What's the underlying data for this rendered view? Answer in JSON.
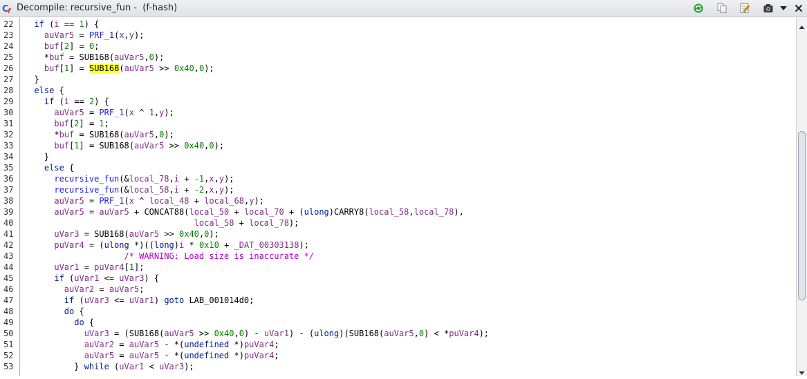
{
  "window": {
    "title": "Decompile: recursive_fun -  (f-hash)",
    "icons": [
      "decompile-logo-icon",
      "refresh-icon",
      "copy-icon",
      "edit-icon",
      "snapshot-icon",
      "menu-chevron-icon",
      "close-icon"
    ]
  },
  "colors": {
    "keyword": "#001a8c",
    "function": "#1e1ee0",
    "variable": "#7d2d83",
    "constant": "#008000",
    "comment": "#b000c8",
    "highlight": "#ffff40"
  },
  "lines": [
    {
      "n": "22",
      "i": 1,
      "t": [
        {
          "c": "kw",
          "s": "if"
        },
        {
          "s": " ("
        },
        {
          "c": "var",
          "s": "i"
        },
        {
          "s": " == "
        },
        {
          "c": "num",
          "s": "1"
        },
        {
          "s": ") {"
        }
      ]
    },
    {
      "n": "23",
      "i": 2,
      "t": [
        {
          "c": "var",
          "s": "auVar5"
        },
        {
          "s": " = "
        },
        {
          "c": "fn",
          "s": "PRF_1"
        },
        {
          "s": "("
        },
        {
          "c": "var",
          "s": "x"
        },
        {
          "s": ","
        },
        {
          "c": "var",
          "s": "y"
        },
        {
          "s": ");"
        }
      ]
    },
    {
      "n": "24",
      "i": 2,
      "t": [
        {
          "c": "var",
          "s": "buf"
        },
        {
          "s": "["
        },
        {
          "c": "num",
          "s": "2"
        },
        {
          "s": "] = "
        },
        {
          "c": "num",
          "s": "0"
        },
        {
          "s": ";"
        }
      ]
    },
    {
      "n": "25",
      "i": 2,
      "t": [
        {
          "s": "*"
        },
        {
          "c": "var",
          "s": "buf"
        },
        {
          "s": " = SUB168("
        },
        {
          "c": "var",
          "s": "auVar5"
        },
        {
          "s": ","
        },
        {
          "c": "num",
          "s": "0"
        },
        {
          "s": ");"
        }
      ]
    },
    {
      "n": "26",
      "i": 2,
      "t": [
        {
          "c": "var",
          "s": "buf"
        },
        {
          "s": "["
        },
        {
          "c": "num",
          "s": "1"
        },
        {
          "s": "] = "
        },
        {
          "c": "hl",
          "s": "SUB168"
        },
        {
          "s": "("
        },
        {
          "c": "var",
          "s": "auVar5"
        },
        {
          "s": " >> "
        },
        {
          "c": "num",
          "s": "0x40"
        },
        {
          "s": ","
        },
        {
          "c": "num",
          "s": "0"
        },
        {
          "s": ");"
        }
      ]
    },
    {
      "n": "27",
      "i": 1,
      "t": [
        {
          "s": "}"
        }
      ]
    },
    {
      "n": "28",
      "i": 1,
      "t": [
        {
          "c": "kw",
          "s": "else"
        },
        {
          "s": " {"
        }
      ]
    },
    {
      "n": "29",
      "i": 2,
      "t": [
        {
          "c": "kw",
          "s": "if"
        },
        {
          "s": " ("
        },
        {
          "c": "var",
          "s": "i"
        },
        {
          "s": " == "
        },
        {
          "c": "num",
          "s": "2"
        },
        {
          "s": ") {"
        }
      ]
    },
    {
      "n": "30",
      "i": 3,
      "t": [
        {
          "c": "var",
          "s": "auVar5"
        },
        {
          "s": " = "
        },
        {
          "c": "fn",
          "s": "PRF_1"
        },
        {
          "s": "("
        },
        {
          "c": "var",
          "s": "x"
        },
        {
          "s": " ^ "
        },
        {
          "c": "num",
          "s": "1"
        },
        {
          "s": ","
        },
        {
          "c": "var",
          "s": "y"
        },
        {
          "s": ");"
        }
      ]
    },
    {
      "n": "31",
      "i": 3,
      "t": [
        {
          "c": "var",
          "s": "buf"
        },
        {
          "s": "["
        },
        {
          "c": "num",
          "s": "2"
        },
        {
          "s": "] = "
        },
        {
          "c": "num",
          "s": "1"
        },
        {
          "s": ";"
        }
      ]
    },
    {
      "n": "32",
      "i": 3,
      "t": [
        {
          "s": "*"
        },
        {
          "c": "var",
          "s": "buf"
        },
        {
          "s": " = SUB168("
        },
        {
          "c": "var",
          "s": "auVar5"
        },
        {
          "s": ","
        },
        {
          "c": "num",
          "s": "0"
        },
        {
          "s": ");"
        }
      ]
    },
    {
      "n": "33",
      "i": 3,
      "t": [
        {
          "c": "var",
          "s": "buf"
        },
        {
          "s": "["
        },
        {
          "c": "num",
          "s": "1"
        },
        {
          "s": "] = SUB168("
        },
        {
          "c": "var",
          "s": "auVar5"
        },
        {
          "s": " >> "
        },
        {
          "c": "num",
          "s": "0x40"
        },
        {
          "s": ","
        },
        {
          "c": "num",
          "s": "0"
        },
        {
          "s": ");"
        }
      ]
    },
    {
      "n": "34",
      "i": 2,
      "t": [
        {
          "s": "}"
        }
      ]
    },
    {
      "n": "35",
      "i": 2,
      "t": [
        {
          "c": "kw",
          "s": "else"
        },
        {
          "s": " {"
        }
      ]
    },
    {
      "n": "36",
      "i": 3,
      "t": [
        {
          "c": "fn",
          "s": "recursive_fun"
        },
        {
          "s": "(&"
        },
        {
          "c": "var",
          "s": "local_78"
        },
        {
          "s": ","
        },
        {
          "c": "var",
          "s": "i"
        },
        {
          "s": " + "
        },
        {
          "c": "num",
          "s": "-1"
        },
        {
          "s": ","
        },
        {
          "c": "var",
          "s": "x"
        },
        {
          "s": ","
        },
        {
          "c": "var",
          "s": "y"
        },
        {
          "s": ");"
        }
      ]
    },
    {
      "n": "37",
      "i": 3,
      "t": [
        {
          "c": "fn",
          "s": "recursive_fun"
        },
        {
          "s": "(&"
        },
        {
          "c": "var",
          "s": "local_58"
        },
        {
          "s": ","
        },
        {
          "c": "var",
          "s": "i"
        },
        {
          "s": " + "
        },
        {
          "c": "num",
          "s": "-2"
        },
        {
          "s": ","
        },
        {
          "c": "var",
          "s": "x"
        },
        {
          "s": ","
        },
        {
          "c": "var",
          "s": "y"
        },
        {
          "s": ");"
        }
      ]
    },
    {
      "n": "38",
      "i": 3,
      "t": [
        {
          "c": "var",
          "s": "auVar5"
        },
        {
          "s": " = "
        },
        {
          "c": "fn",
          "s": "PRF_1"
        },
        {
          "s": "("
        },
        {
          "c": "var",
          "s": "x"
        },
        {
          "s": " ^ "
        },
        {
          "c": "var",
          "s": "local_48"
        },
        {
          "s": " + "
        },
        {
          "c": "var",
          "s": "local_68"
        },
        {
          "s": ","
        },
        {
          "c": "var",
          "s": "y"
        },
        {
          "s": ");"
        }
      ]
    },
    {
      "n": "39",
      "i": 3,
      "t": [
        {
          "c": "var",
          "s": "auVar5"
        },
        {
          "s": " = "
        },
        {
          "c": "var",
          "s": "auVar5"
        },
        {
          "s": " + CONCAT88("
        },
        {
          "c": "var",
          "s": "local_50"
        },
        {
          "s": " + "
        },
        {
          "c": "var",
          "s": "local_70"
        },
        {
          "s": " + ("
        },
        {
          "c": "kw",
          "s": "ulong"
        },
        {
          "s": ")CARRY8("
        },
        {
          "c": "var",
          "s": "local_58"
        },
        {
          "s": ","
        },
        {
          "c": "var",
          "s": "local_78"
        },
        {
          "s": "),"
        }
      ]
    },
    {
      "n": "40",
      "i": 0,
      "t": [
        {
          "s": "                                  "
        },
        {
          "c": "var",
          "s": "local_58"
        },
        {
          "s": " + "
        },
        {
          "c": "var",
          "s": "local_78"
        },
        {
          "s": ");"
        }
      ]
    },
    {
      "n": "41",
      "i": 3,
      "t": [
        {
          "c": "var",
          "s": "uVar3"
        },
        {
          "s": " = SUB168("
        },
        {
          "c": "var",
          "s": "auVar5"
        },
        {
          "s": " >> "
        },
        {
          "c": "num",
          "s": "0x40"
        },
        {
          "s": ","
        },
        {
          "c": "num",
          "s": "0"
        },
        {
          "s": ");"
        }
      ]
    },
    {
      "n": "42",
      "i": 3,
      "t": [
        {
          "c": "var",
          "s": "puVar4"
        },
        {
          "s": " = ("
        },
        {
          "c": "kw",
          "s": "ulong"
        },
        {
          "s": " *)(("
        },
        {
          "c": "kw",
          "s": "long"
        },
        {
          "s": ")"
        },
        {
          "c": "var",
          "s": "i"
        },
        {
          "s": " * "
        },
        {
          "c": "num",
          "s": "0x10"
        },
        {
          "s": " + "
        },
        {
          "c": "gv",
          "s": "_DAT_00303138"
        },
        {
          "s": ");"
        }
      ]
    },
    {
      "n": "43",
      "i": 0,
      "t": [
        {
          "s": "                    "
        },
        {
          "c": "cm",
          "s": "/* WARNING: Load size is inaccurate */"
        }
      ]
    },
    {
      "n": "44",
      "i": 3,
      "t": [
        {
          "c": "var",
          "s": "uVar1"
        },
        {
          "s": " = "
        },
        {
          "c": "var",
          "s": "puVar4"
        },
        {
          "s": "["
        },
        {
          "c": "num",
          "s": "1"
        },
        {
          "s": "];"
        }
      ]
    },
    {
      "n": "45",
      "i": 3,
      "t": [
        {
          "c": "kw",
          "s": "if"
        },
        {
          "s": " ("
        },
        {
          "c": "var",
          "s": "uVar1"
        },
        {
          "s": " <= "
        },
        {
          "c": "var",
          "s": "uVar3"
        },
        {
          "s": ") {"
        }
      ]
    },
    {
      "n": "46",
      "i": 4,
      "t": [
        {
          "c": "var",
          "s": "auVar2"
        },
        {
          "s": " = "
        },
        {
          "c": "var",
          "s": "auVar5"
        },
        {
          "s": ";"
        }
      ]
    },
    {
      "n": "47",
      "i": 4,
      "t": [
        {
          "c": "kw",
          "s": "if"
        },
        {
          "s": " ("
        },
        {
          "c": "var",
          "s": "uVar3"
        },
        {
          "s": " <= "
        },
        {
          "c": "var",
          "s": "uVar1"
        },
        {
          "s": ") "
        },
        {
          "c": "kw",
          "s": "goto"
        },
        {
          "s": " LAB_001014d0;"
        }
      ]
    },
    {
      "n": "48",
      "i": 4,
      "t": [
        {
          "c": "kw",
          "s": "do"
        },
        {
          "s": " {"
        }
      ]
    },
    {
      "n": "49",
      "i": 5,
      "t": [
        {
          "c": "kw",
          "s": "do"
        },
        {
          "s": " {"
        }
      ]
    },
    {
      "n": "50",
      "i": 6,
      "t": [
        {
          "c": "var",
          "s": "uVar3"
        },
        {
          "s": " = (SUB168("
        },
        {
          "c": "var",
          "s": "auVar5"
        },
        {
          "s": " >> "
        },
        {
          "c": "num",
          "s": "0x40"
        },
        {
          "s": ","
        },
        {
          "c": "num",
          "s": "0"
        },
        {
          "s": ") - "
        },
        {
          "c": "var",
          "s": "uVar1"
        },
        {
          "s": ") - ("
        },
        {
          "c": "kw",
          "s": "ulong"
        },
        {
          "s": ")(SUB168("
        },
        {
          "c": "var",
          "s": "auVar5"
        },
        {
          "s": ","
        },
        {
          "c": "num",
          "s": "0"
        },
        {
          "s": ") < *"
        },
        {
          "c": "var",
          "s": "puVar4"
        },
        {
          "s": ");"
        }
      ]
    },
    {
      "n": "51",
      "i": 6,
      "t": [
        {
          "c": "var",
          "s": "auVar2"
        },
        {
          "s": " = "
        },
        {
          "c": "var",
          "s": "auVar5"
        },
        {
          "s": " - *("
        },
        {
          "c": "kw",
          "s": "undefined"
        },
        {
          "s": " *)"
        },
        {
          "c": "var",
          "s": "puVar4"
        },
        {
          "s": ";"
        }
      ]
    },
    {
      "n": "52",
      "i": 6,
      "t": [
        {
          "c": "var",
          "s": "auVar5"
        },
        {
          "s": " = "
        },
        {
          "c": "var",
          "s": "auVar5"
        },
        {
          "s": " - *("
        },
        {
          "c": "kw",
          "s": "undefined"
        },
        {
          "s": " *)"
        },
        {
          "c": "var",
          "s": "puVar4"
        },
        {
          "s": ";"
        }
      ]
    },
    {
      "n": "53",
      "i": 5,
      "t": [
        {
          "s": "} "
        },
        {
          "c": "kw",
          "s": "while"
        },
        {
          "s": " ("
        },
        {
          "c": "var",
          "s": "uVar1"
        },
        {
          "s": " < "
        },
        {
          "c": "var",
          "s": "uVar3"
        },
        {
          "s": ");"
        }
      ]
    }
  ]
}
